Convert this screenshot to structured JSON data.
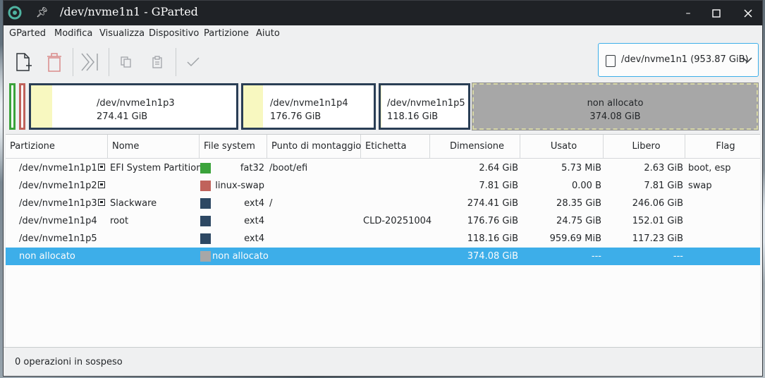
{
  "window": {
    "title": "/dev/nvme1n1 - GParted"
  },
  "menu": [
    "GParted",
    "Modifica",
    "Visualizza",
    "Dispositivo",
    "Partizione",
    "Aiuto"
  ],
  "toolbar": {
    "icons": [
      "new-partition-icon",
      "delete-icon",
      "resize-move-icon",
      "copy-icon",
      "paste-icon",
      "apply-icon"
    ]
  },
  "device": {
    "label": "/dev/nvme1n1 (953.87 GiB)"
  },
  "diskmap": {
    "partitions": [
      {
        "name": "/dev/nvme1n1p3",
        "size": "274.41 GiB"
      },
      {
        "name": "/dev/nvme1n1p4",
        "size": "176.76 GiB"
      },
      {
        "name": "/dev/nvme1n1p5",
        "size": "118.16 GiB"
      },
      {
        "name": "non allocato",
        "size": "374.08 GiB"
      }
    ]
  },
  "table": {
    "headers": [
      "Partizione",
      "Nome",
      "File system",
      "Punto di montaggio",
      "Etichetta",
      "Dimensione",
      "Usato",
      "Libero",
      "Flag"
    ],
    "rows": [
      {
        "partition": "/dev/nvme1n1p1",
        "name": "EFI System Partition",
        "fs": "fat32",
        "fs_color": "#3ba33b",
        "mount": "/boot/efi",
        "label": "",
        "size": "2.64 GiB",
        "used": "5.73 MiB",
        "free": "2.63 GiB",
        "flags": "boot, esp"
      },
      {
        "partition": "/dev/nvme1n1p2",
        "name": "",
        "fs": "linux-swap",
        "fs_color": "#c0625b",
        "mount": "",
        "label": "",
        "size": "7.81 GiB",
        "used": "0.00 B",
        "free": "7.81 GiB",
        "flags": "swap"
      },
      {
        "partition": "/dev/nvme1n1p3",
        "name": "Slackware",
        "fs": "ext4",
        "fs_color": "#2d4863",
        "mount": "/",
        "label": "",
        "size": "274.41 GiB",
        "used": "28.35 GiB",
        "free": "246.06 GiB",
        "flags": ""
      },
      {
        "partition": "/dev/nvme1n1p4",
        "name": "root",
        "fs": "ext4",
        "fs_color": "#2d4863",
        "mount": "",
        "label": "CLD-20251004",
        "size": "176.76 GiB",
        "used": "24.75 GiB",
        "free": "152.01 GiB",
        "flags": ""
      },
      {
        "partition": "/dev/nvme1n1p5",
        "name": "",
        "fs": "ext4",
        "fs_color": "#2d4863",
        "mount": "",
        "label": "",
        "size": "118.16 GiB",
        "used": "959.69 MiB",
        "free": "117.23 GiB",
        "flags": ""
      },
      {
        "partition": "non allocato",
        "name": "",
        "fs": "non allocato",
        "fs_color": "#a7a7a7",
        "mount": "",
        "label": "",
        "size": "374.08 GiB",
        "used": "---",
        "free": "---",
        "flags": ""
      }
    ]
  },
  "status": {
    "text": "0 operazioni in sospeso"
  }
}
